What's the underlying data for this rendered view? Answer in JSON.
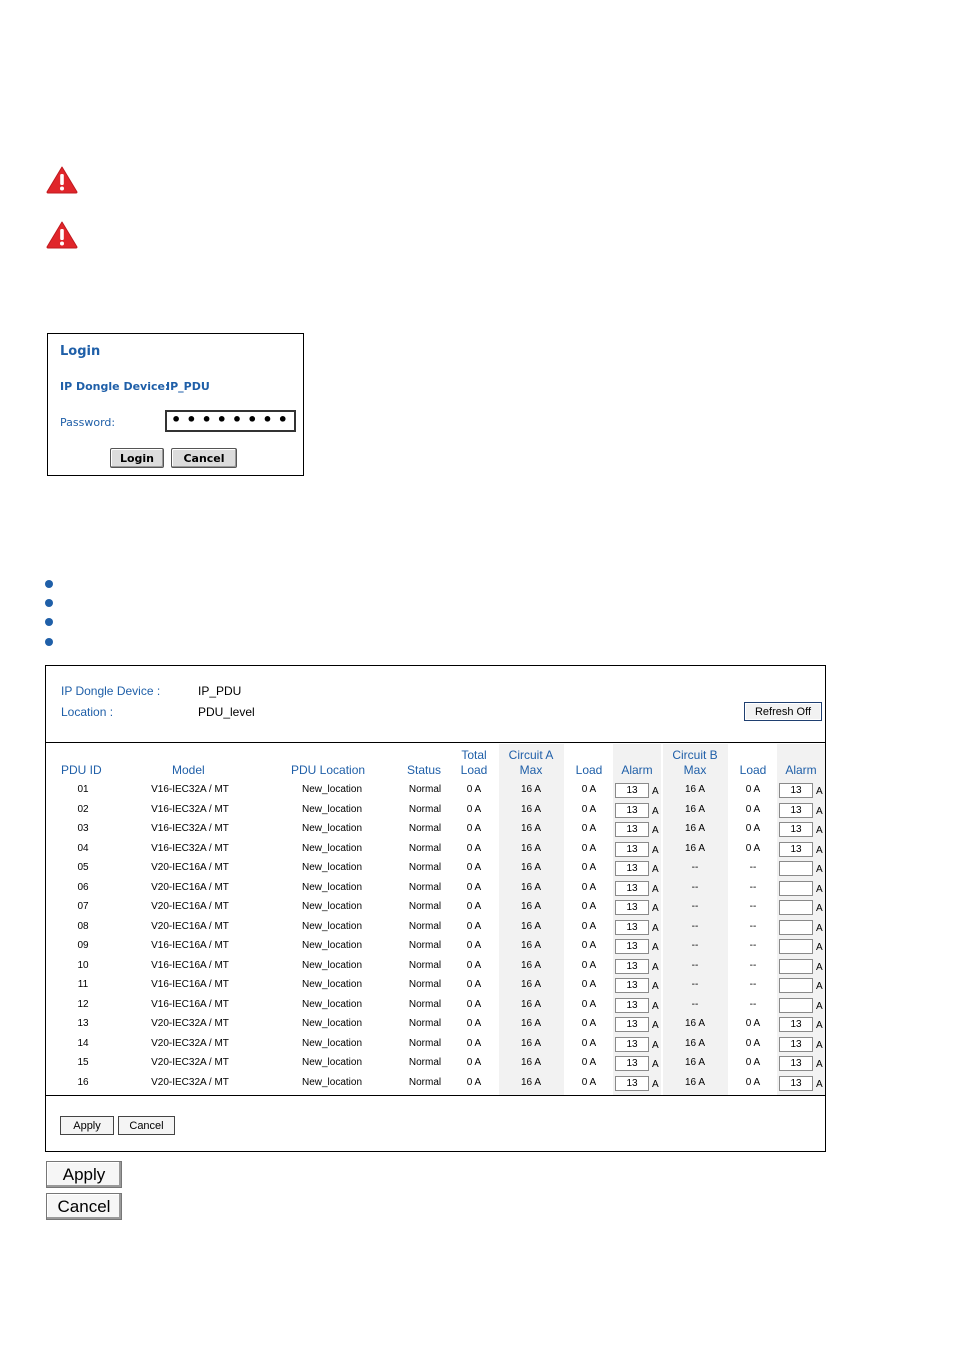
{
  "login": {
    "title": "Login",
    "device_label": "IP Dongle Device:",
    "device_value": "IP_PDU",
    "password_label": "Password:",
    "password_value": "••••••••",
    "login_button": "Login",
    "cancel_button": "Cancel"
  },
  "panel": {
    "device_label": "IP Dongle Device :",
    "device_value": "IP_PDU",
    "location_label": "Location :",
    "location_value": "PDU_level",
    "refresh_button": "Refresh Off",
    "headers": {
      "pdu_id": "PDU ID",
      "model": "Model",
      "pdu_location": "PDU Location",
      "status": "Status",
      "total_load_1": "Total",
      "total_load_2": "Load",
      "circuit_a_1": "Circuit A",
      "circuit_a_2": "Max",
      "load_a": "Load",
      "alarm_a": "Alarm",
      "circuit_b_1": "Circuit B",
      "circuit_b_2": "Max",
      "load_b": "Load",
      "alarm_b": "Alarm"
    },
    "unit": "A",
    "rows": [
      {
        "id": "01",
        "model": "V16-IEC32A / MT",
        "location": "New_location",
        "status": "Normal",
        "total": "0 A",
        "a_max": "16 A",
        "a_load": "0 A",
        "a_alarm": "13",
        "b_max": "16 A",
        "b_load": "0 A",
        "b_alarm": "13"
      },
      {
        "id": "02",
        "model": "V16-IEC32A / MT",
        "location": "New_location",
        "status": "Normal",
        "total": "0 A",
        "a_max": "16 A",
        "a_load": "0 A",
        "a_alarm": "13",
        "b_max": "16 A",
        "b_load": "0 A",
        "b_alarm": "13"
      },
      {
        "id": "03",
        "model": "V16-IEC32A / MT",
        "location": "New_location",
        "status": "Normal",
        "total": "0 A",
        "a_max": "16 A",
        "a_load": "0 A",
        "a_alarm": "13",
        "b_max": "16 A",
        "b_load": "0 A",
        "b_alarm": "13"
      },
      {
        "id": "04",
        "model": "V16-IEC32A / MT",
        "location": "New_location",
        "status": "Normal",
        "total": "0 A",
        "a_max": "16 A",
        "a_load": "0 A",
        "a_alarm": "13",
        "b_max": "16 A",
        "b_load": "0 A",
        "b_alarm": "13"
      },
      {
        "id": "05",
        "model": "V20-IEC16A / MT",
        "location": "New_location",
        "status": "Normal",
        "total": "0 A",
        "a_max": "16 A",
        "a_load": "0 A",
        "a_alarm": "13",
        "b_max": "--",
        "b_load": "--",
        "b_alarm": ""
      },
      {
        "id": "06",
        "model": "V20-IEC16A / MT",
        "location": "New_location",
        "status": "Normal",
        "total": "0 A",
        "a_max": "16 A",
        "a_load": "0 A",
        "a_alarm": "13",
        "b_max": "--",
        "b_load": "--",
        "b_alarm": ""
      },
      {
        "id": "07",
        "model": "V20-IEC16A / MT",
        "location": "New_location",
        "status": "Normal",
        "total": "0 A",
        "a_max": "16 A",
        "a_load": "0 A",
        "a_alarm": "13",
        "b_max": "--",
        "b_load": "--",
        "b_alarm": ""
      },
      {
        "id": "08",
        "model": "V20-IEC16A / MT",
        "location": "New_location",
        "status": "Normal",
        "total": "0 A",
        "a_max": "16 A",
        "a_load": "0 A",
        "a_alarm": "13",
        "b_max": "--",
        "b_load": "--",
        "b_alarm": ""
      },
      {
        "id": "09",
        "model": "V16-IEC16A / MT",
        "location": "New_location",
        "status": "Normal",
        "total": "0 A",
        "a_max": "16 A",
        "a_load": "0 A",
        "a_alarm": "13",
        "b_max": "--",
        "b_load": "--",
        "b_alarm": ""
      },
      {
        "id": "10",
        "model": "V16-IEC16A / MT",
        "location": "New_location",
        "status": "Normal",
        "total": "0 A",
        "a_max": "16 A",
        "a_load": "0 A",
        "a_alarm": "13",
        "b_max": "--",
        "b_load": "--",
        "b_alarm": ""
      },
      {
        "id": "11",
        "model": "V16-IEC16A / MT",
        "location": "New_location",
        "status": "Normal",
        "total": "0 A",
        "a_max": "16 A",
        "a_load": "0 A",
        "a_alarm": "13",
        "b_max": "--",
        "b_load": "--",
        "b_alarm": ""
      },
      {
        "id": "12",
        "model": "V16-IEC16A / MT",
        "location": "New_location",
        "status": "Normal",
        "total": "0 A",
        "a_max": "16 A",
        "a_load": "0 A",
        "a_alarm": "13",
        "b_max": "--",
        "b_load": "--",
        "b_alarm": ""
      },
      {
        "id": "13",
        "model": "V20-IEC32A / MT",
        "location": "New_location",
        "status": "Normal",
        "total": "0 A",
        "a_max": "16 A",
        "a_load": "0 A",
        "a_alarm": "13",
        "b_max": "16 A",
        "b_load": "0 A",
        "b_alarm": "13"
      },
      {
        "id": "14",
        "model": "V20-IEC32A / MT",
        "location": "New_location",
        "status": "Normal",
        "total": "0 A",
        "a_max": "16 A",
        "a_load": "0 A",
        "a_alarm": "13",
        "b_max": "16 A",
        "b_load": "0 A",
        "b_alarm": "13"
      },
      {
        "id": "15",
        "model": "V20-IEC32A / MT",
        "location": "New_location",
        "status": "Normal",
        "total": "0 A",
        "a_max": "16 A",
        "a_load": "0 A",
        "a_alarm": "13",
        "b_max": "16 A",
        "b_load": "0 A",
        "b_alarm": "13"
      },
      {
        "id": "16",
        "model": "V20-IEC32A / MT",
        "location": "New_location",
        "status": "Normal",
        "total": "0 A",
        "a_max": "16 A",
        "a_load": "0 A",
        "a_alarm": "13",
        "b_max": "16 A",
        "b_load": "0 A",
        "b_alarm": "13"
      }
    ],
    "apply_button": "Apply",
    "cancel_button": "Cancel"
  },
  "standalone_buttons": {
    "apply": "Apply",
    "cancel": "Cancel"
  },
  "icons": {
    "warning": "warning-icon",
    "bullet": "bullet-icon"
  },
  "colors": {
    "label_blue": "#1f5fa8",
    "warning_red": "#e0262b",
    "column_shade": "#f2f2f2"
  }
}
